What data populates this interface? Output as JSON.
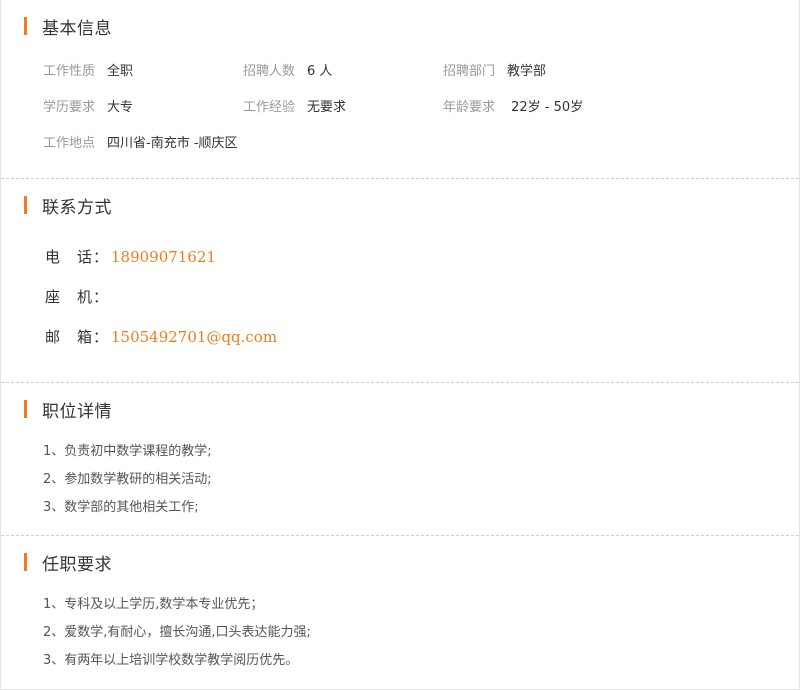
{
  "basic": {
    "title": "基本信息",
    "rows": [
      [
        {
          "label": "工作性质",
          "value": "全职"
        },
        {
          "label": "招聘人数",
          "value": "6 人"
        },
        {
          "label": "招聘部门",
          "value": "教学部"
        }
      ],
      [
        {
          "label": "学历要求",
          "value": "大专"
        },
        {
          "label": "工作经验",
          "value": "无要求"
        },
        {
          "label": "年龄要求",
          "value": " 22岁 - 50岁"
        }
      ],
      [
        {
          "label": "工作地点",
          "value": "四川省-南充市 -顺庆区"
        }
      ]
    ]
  },
  "contact": {
    "title": "联系方式",
    "phone_label": "电　话：",
    "phone_value": "18909071621",
    "landline_label": "座　机：",
    "landline_value": "",
    "email_label": "邮　箱：",
    "email_value": "1505492701@qq.com"
  },
  "detail": {
    "title": "职位详情",
    "lines": [
      "1、负责初中数学课程的教学;",
      "2、参加数学教研的相关活动;",
      "3、数学部的其他相关工作;"
    ]
  },
  "requirements": {
    "title": "任职要求",
    "lines": [
      "1、专科及以上学历,数学本专业优先；",
      "2、爱数学,有耐心，擅长沟通,口头表达能力强;",
      "3、有两年以上培训学校数学教学阅历优先。"
    ]
  },
  "colors": {
    "accent": "#f07d1c",
    "label": "#999999",
    "text": "#333333"
  }
}
